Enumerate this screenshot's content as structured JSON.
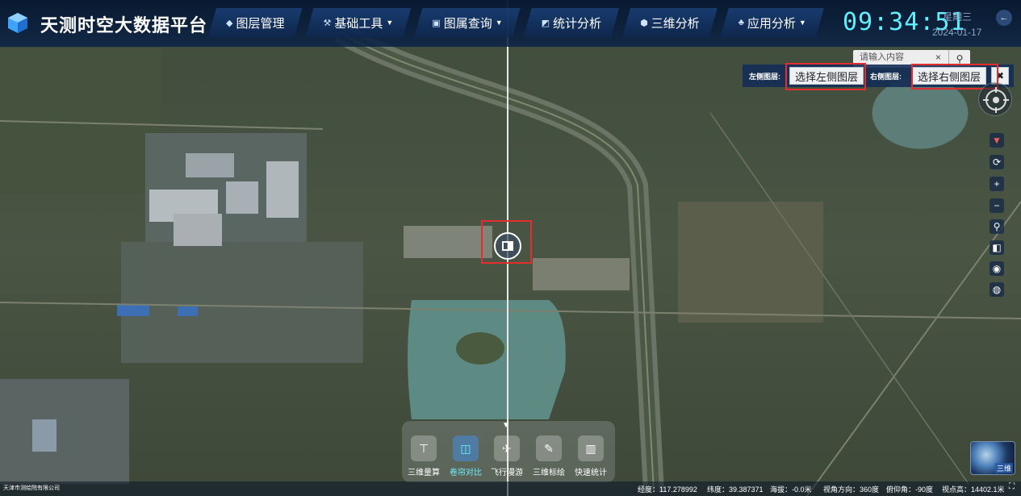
{
  "header": {
    "title": "天测时空大数据平台",
    "nav": [
      {
        "label": "图层管理",
        "icon": "layers-icon",
        "dropdown": false
      },
      {
        "label": "基础工具",
        "icon": "tools-icon",
        "dropdown": true
      },
      {
        "label": "图属查询",
        "icon": "query-icon",
        "dropdown": true
      },
      {
        "label": "统计分析",
        "icon": "chart-icon",
        "dropdown": false
      },
      {
        "label": "三维分析",
        "icon": "cube-icon",
        "dropdown": false
      },
      {
        "label": "应用分析",
        "icon": "apps-icon",
        "dropdown": true
      }
    ],
    "clock": "09:34:51",
    "weekday": "星期三",
    "date": "2024-01-17"
  },
  "search": {
    "placeholder": "请输入内容",
    "clear": "×"
  },
  "compare": {
    "left_label": "左侧图层:",
    "left_button": "选择左侧图层",
    "right_label": "右侧图层:",
    "right_button": "选择右侧图层",
    "close": "✖"
  },
  "dock": {
    "items": [
      {
        "label": "三维量算",
        "active": false
      },
      {
        "label": "卷帘对比",
        "active": true
      },
      {
        "label": "飞行漫游",
        "active": false
      },
      {
        "label": "三维标绘",
        "active": false
      },
      {
        "label": "快速统计",
        "active": false
      }
    ]
  },
  "status": {
    "logo": "天津市测绘院有限公司",
    "longitude": "经度：117.278992",
    "latitude": "纬度：39.387371",
    "altitude": "海拔：-0.0米",
    "heading": "视角方向：360度",
    "pitch": "俯仰角：-90度",
    "height": "视点高：14402.1米"
  },
  "globe_label": "三维",
  "colors": {
    "accent": "#5ff0ff",
    "highlight": "#e52d2d",
    "header": "#0a2246"
  }
}
